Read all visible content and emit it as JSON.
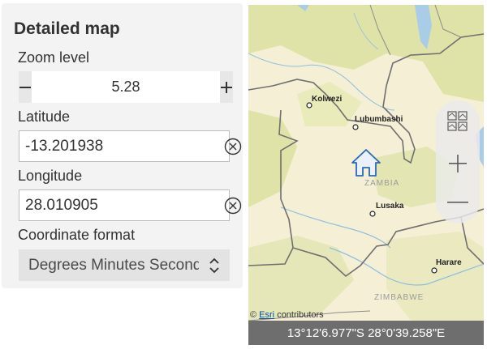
{
  "panel": {
    "title": "Detailed map",
    "zoom": {
      "label": "Zoom level",
      "value": "5.28"
    },
    "latitude": {
      "label": "Latitude",
      "value": "-13.201938"
    },
    "longitude": {
      "label": "Longitude",
      "value": "28.010905"
    },
    "coordinate_format": {
      "label": "Coordinate format",
      "selected": "Degrees Minutes Seconds"
    }
  },
  "map": {
    "cities": [
      {
        "id": "kolwezi",
        "name": "Kolwezi"
      },
      {
        "id": "lubumbashi",
        "name": "Lubumbashi"
      },
      {
        "id": "lusaka",
        "name": "Lusaka"
      },
      {
        "id": "harare",
        "name": "Harare"
      }
    ],
    "countries": [
      {
        "id": "zambia",
        "name": "ZAMBIA"
      },
      {
        "id": "zimbabwe",
        "name": "ZIMBABWE"
      }
    ],
    "attribution": {
      "copyright": "©",
      "link": "Esri",
      "suffix": "contributors"
    },
    "coordinate_display": "13°12'6.977\"S 28°0'39.258\"E",
    "icons": {
      "home": "home-icon",
      "basemap": "basemap-gallery-icon",
      "zoom_in": "plus-icon",
      "zoom_out": "minus-icon"
    }
  },
  "colors": {
    "panel_bg": "#f3f3f3",
    "land": "#f4efd5",
    "vegetation": "#dfe3a8",
    "water": "#a9cde6",
    "border": "#6f6f6f",
    "home_icon": "#2b68b8",
    "coord_bar": "#6e6e6e"
  }
}
